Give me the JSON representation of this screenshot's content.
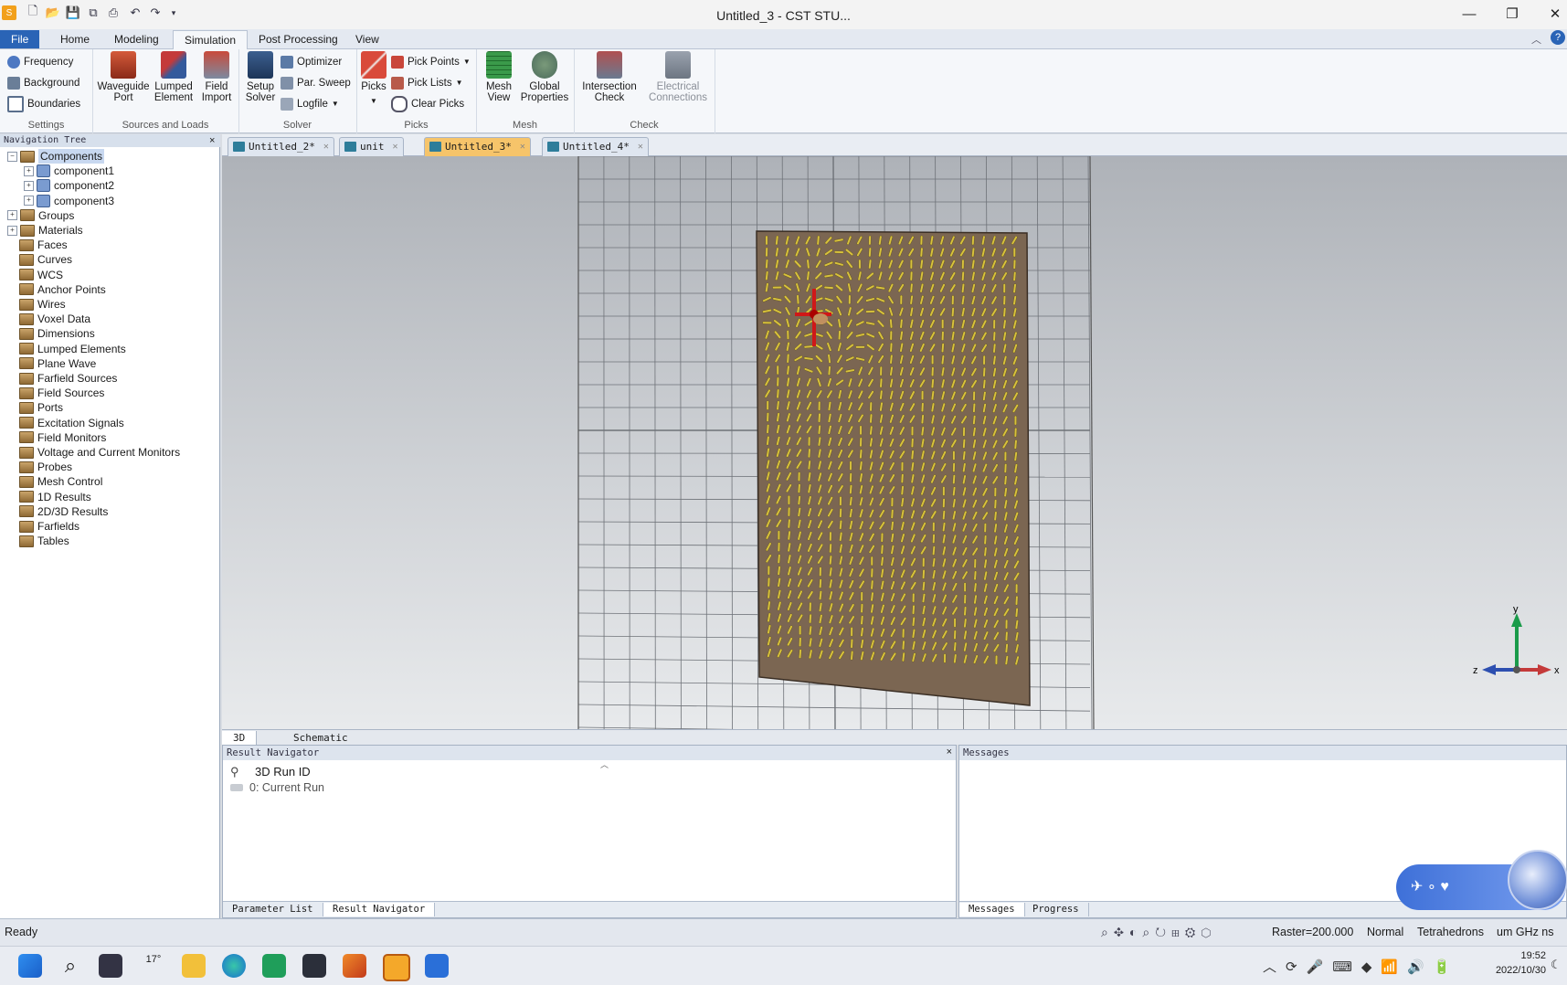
{
  "window": {
    "title": "Untitled_3 - CST STU...",
    "minimize": "—",
    "restore": "❐",
    "close": "✕"
  },
  "menu": {
    "tabs": [
      "File",
      "Home",
      "Modeling",
      "Simulation",
      "Post Processing",
      "View"
    ],
    "active": "Simulation"
  },
  "ribbon": {
    "settings": {
      "label": "Settings",
      "items": [
        "Frequency",
        "Background",
        "Boundaries"
      ]
    },
    "sources": {
      "label": "Sources and Loads",
      "items": [
        [
          "Waveguide",
          "Port"
        ],
        [
          "Lumped",
          "Element"
        ],
        [
          "Field",
          "Import"
        ]
      ]
    },
    "solver": {
      "label": "Solver",
      "setup": [
        "Setup",
        "Solver"
      ],
      "items": [
        "Optimizer",
        "Par. Sweep",
        "Logfile"
      ]
    },
    "picks": {
      "label": "Picks",
      "picks": "Picks",
      "items": [
        "Pick Points",
        "Pick Lists",
        "Clear Picks"
      ]
    },
    "mesh": {
      "label": "Mesh",
      "items": [
        [
          "Mesh",
          "View"
        ],
        [
          "Global",
          "Properties"
        ]
      ]
    },
    "check": {
      "label": "Check",
      "items": [
        [
          "Intersection",
          "Check"
        ],
        [
          "Electrical",
          "Connections"
        ]
      ]
    }
  },
  "nav": {
    "title": "Navigation Tree",
    "close": "×",
    "items": [
      "Components",
      "component1",
      "component2",
      "component3",
      "Groups",
      "Materials",
      "Faces",
      "Curves",
      "WCS",
      "Anchor Points",
      "Wires",
      "Voxel Data",
      "Dimensions",
      "Lumped Elements",
      "Plane Wave",
      "Farfield Sources",
      "Field Sources",
      "Ports",
      "Excitation Signals",
      "Field Monitors",
      "Voltage and Current Monitors",
      "Probes",
      "Mesh Control",
      "1D Results",
      "2D/3D Results",
      "Farfields",
      "Tables"
    ]
  },
  "doc_tabs": [
    "Untitled_2*",
    "unit",
    "Untitled_3*",
    "Untitled_4*"
  ],
  "doc_tab_active": "Untitled_3*",
  "view_tabs": [
    "3D",
    "Schematic"
  ],
  "axes": {
    "y": "y",
    "x": "x",
    "z": "z"
  },
  "result_nav": {
    "title": "Result Navigator",
    "close": "×",
    "run_header": "3D Run ID",
    "run_item": "0: Current Run",
    "footer_tabs": [
      "Parameter List",
      "Result Navigator"
    ]
  },
  "messages": {
    "title": "Messages",
    "footer_tabs": [
      "Messages",
      "Progress"
    ]
  },
  "status": {
    "text": "Ready",
    "raster": "Raster=200.000",
    "mode": "Normal",
    "mesh": "Tetrahedrons",
    "units": "um  GHz  ns"
  },
  "taskbar": {
    "temp": "17°",
    "time": "19:52",
    "date": "2022/10/30"
  },
  "colors": {
    "accent": "#2a64b6",
    "active_tab": "#f6c46a",
    "metasurface": "#7b6652",
    "element": "#d8c23c"
  }
}
